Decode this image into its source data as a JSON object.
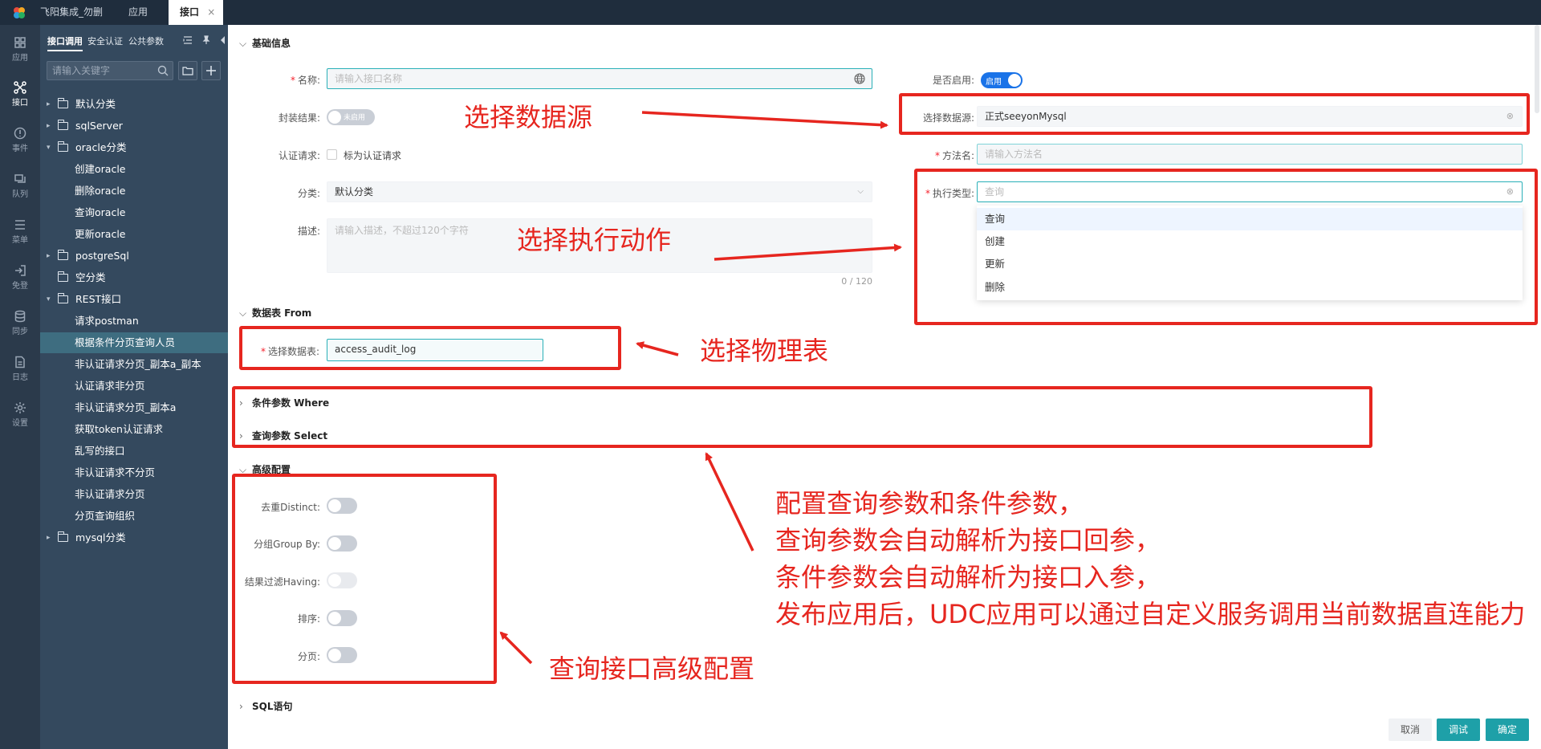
{
  "topbar": {
    "tabs": [
      {
        "label": "飞阳集成_勿删"
      },
      {
        "label": "应用"
      },
      {
        "label": "接口"
      }
    ],
    "close_glyph": "×"
  },
  "rail": {
    "items": [
      {
        "label": "应用",
        "icon": "grid-icon"
      },
      {
        "label": "接口",
        "icon": "connect-icon"
      },
      {
        "label": "事件",
        "icon": "alert-icon"
      },
      {
        "label": "队列",
        "icon": "queue-icon"
      },
      {
        "label": "菜单",
        "icon": "menu-icon"
      },
      {
        "label": "免登",
        "icon": "login-icon"
      },
      {
        "label": "同步",
        "icon": "database-icon"
      },
      {
        "label": "日志",
        "icon": "log-icon"
      },
      {
        "label": "设置",
        "icon": "gear-icon"
      }
    ]
  },
  "sidebar": {
    "tabs": [
      "接口调用",
      "安全认证",
      "公共参数"
    ],
    "search_placeholder": "请输入关键字",
    "tree": [
      {
        "label": "默认分类",
        "type": "folder",
        "expanded": false
      },
      {
        "label": "sqlServer",
        "type": "folder",
        "expanded": false
      },
      {
        "label": "oracle分类",
        "type": "folder",
        "expanded": true
      },
      {
        "label": "创建oracle",
        "type": "leaf"
      },
      {
        "label": "删除oracle",
        "type": "leaf"
      },
      {
        "label": "查询oracle",
        "type": "leaf"
      },
      {
        "label": "更新oracle",
        "type": "leaf"
      },
      {
        "label": "postgreSql",
        "type": "folder",
        "expanded": false
      },
      {
        "label": "空分类",
        "type": "folder",
        "empty": true
      },
      {
        "label": "REST接口",
        "type": "folder",
        "expanded": true
      },
      {
        "label": "请求postman",
        "type": "leaf"
      },
      {
        "label": "根据条件分页查询人员",
        "type": "leaf",
        "selected": true
      },
      {
        "label": "非认证请求分页_副本a_副本",
        "type": "leaf"
      },
      {
        "label": "认证请求非分页",
        "type": "leaf"
      },
      {
        "label": "非认证请求分页_副本a",
        "type": "leaf"
      },
      {
        "label": "获取token认证请求",
        "type": "leaf"
      },
      {
        "label": "乱写的接口",
        "type": "leaf"
      },
      {
        "label": "非认证请求不分页",
        "type": "leaf"
      },
      {
        "label": "非认证请求分页",
        "type": "leaf"
      },
      {
        "label": "分页查询组织",
        "type": "leaf"
      },
      {
        "label": "mysql分类",
        "type": "folder",
        "expanded": false
      }
    ]
  },
  "form": {
    "basic_title": "基础信息",
    "name_label": "名称:",
    "name_placeholder": "请输入接口名称",
    "wrap_label": "封装结果:",
    "wrap_toggle": "未启用",
    "auth_label": "认证请求:",
    "auth_checkbox": "标为认证请求",
    "category_label": "分类:",
    "category_value": "默认分类",
    "desc_label": "描述:",
    "desc_placeholder": "请输入描述，不超过120个字符",
    "desc_count": "0 / 120",
    "enabled_label": "是否启用:",
    "enabled_toggle": "启用",
    "datasource_label": "选择数据源:",
    "datasource_value": "正式seeyonMysql",
    "method_label": "方法名:",
    "method_placeholder": "请输入方法名",
    "exec_label": "执行类型:",
    "exec_placeholder": "查询",
    "exec_options": [
      "查询",
      "创建",
      "更新",
      "删除"
    ],
    "table_section": "数据表 From",
    "table_label": "选择数据表:",
    "table_value": "access_audit_log",
    "where_section": "条件参数 Where",
    "select_section": "查询参数 Select",
    "advanced_section": "高级配置",
    "distinct_label": "去重Distinct:",
    "groupby_label": "分组Group By:",
    "having_label": "结果过滤Having:",
    "sort_label": "排序:",
    "paging_label": "分页:",
    "sql_section": "SQL语句"
  },
  "footer": {
    "cancel": "取消",
    "debug": "调试",
    "confirm": "确定"
  },
  "annotations": {
    "datasource": "选择数据源",
    "action": "选择执行动作",
    "table": "选择物理表",
    "params": [
      "配置查询参数和条件参数，",
      "查询参数会自动解析为接口回参，",
      "条件参数会自动解析为接口入参，",
      "发布应用后，UDC应用可以通过自定义服务调用当前数据直连能力"
    ],
    "advanced": "查询接口高级配置"
  },
  "colors": {
    "accent": "#1ea0a8",
    "annotation_red": "#e6261f",
    "sidebar_bg": "#34495e",
    "rail_bg": "#2b3a4b",
    "topbar_bg": "#1f2d3d"
  }
}
